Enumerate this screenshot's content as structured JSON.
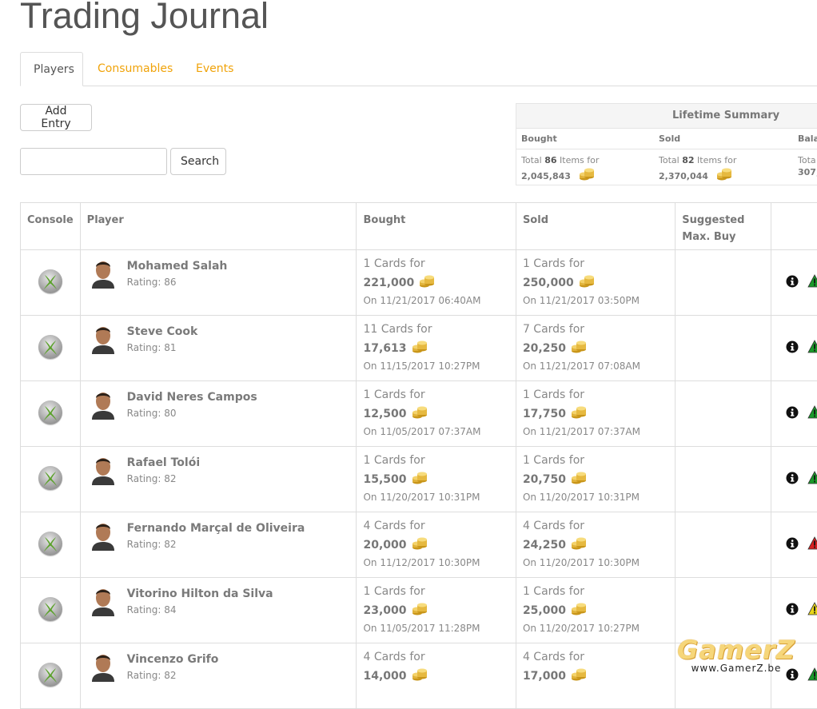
{
  "page": {
    "title": "Trading Journal"
  },
  "tabs": [
    {
      "label": "Players",
      "active": true
    },
    {
      "label": "Consumables",
      "active": false
    },
    {
      "label": "Events",
      "active": false
    }
  ],
  "toolbar": {
    "add_entry_label": "Add Entry",
    "search_label": "Search",
    "search_value": ""
  },
  "summary": {
    "title": "Lifetime Summary",
    "bought": {
      "label": "Bought",
      "prefix": "Total",
      "count": "86",
      "suffix": "Items for",
      "amount": "2,045,843"
    },
    "sold": {
      "label": "Sold",
      "prefix": "Total",
      "count": "82",
      "suffix": "Items for",
      "amount": "2,370,044"
    },
    "balance": {
      "label": "Bala",
      "prefix": "Tota",
      "amount": "307,"
    }
  },
  "table": {
    "headers": {
      "console": "Console",
      "player": "Player",
      "bought": "Bought",
      "sold": "Sold",
      "suggested": "Suggested Max. Buy"
    },
    "rows": [
      {
        "name": "Mohamed Salah",
        "rating": "Rating: 86",
        "bought_cards": "1 Cards for",
        "bought_price": "221,000",
        "bought_date": "On 11/21/2017 06:40AM",
        "sold_cards": "1 Cards for",
        "sold_price": "250,000",
        "sold_date": "On 11/21/2017 03:50PM",
        "warn": "#1a9a2a"
      },
      {
        "name": "Steve Cook",
        "rating": "Rating: 81",
        "bought_cards": "11 Cards for",
        "bought_price": "17,613",
        "bought_date": "On 11/15/2017 10:27PM",
        "sold_cards": "7 Cards for",
        "sold_price": "20,250",
        "sold_date": "On 11/21/2017 07:08AM",
        "warn": "#1a9a2a"
      },
      {
        "name": "David Neres Campos",
        "rating": "Rating: 80",
        "bought_cards": "1 Cards for",
        "bought_price": "12,500",
        "bought_date": "On 11/05/2017 07:37AM",
        "sold_cards": "1 Cards for",
        "sold_price": "17,750",
        "sold_date": "On 11/21/2017 07:37AM",
        "warn": "#1a9a2a"
      },
      {
        "name": "Rafael Tolói",
        "rating": "Rating: 82",
        "bought_cards": "1 Cards for",
        "bought_price": "15,500",
        "bought_date": "On 11/20/2017 10:31PM",
        "sold_cards": "1 Cards for",
        "sold_price": "20,750",
        "sold_date": "On 11/20/2017 10:31PM",
        "warn": "#1a9a2a"
      },
      {
        "name": "Fernando Marçal de Oliveira",
        "rating": "Rating: 82",
        "bought_cards": "4 Cards for",
        "bought_price": "20,000",
        "bought_date": "On 11/12/2017 10:30PM",
        "sold_cards": "4 Cards for",
        "sold_price": "24,250",
        "sold_date": "On 11/20/2017 10:30PM",
        "warn": "#d62020"
      },
      {
        "name": "Vitorino Hilton da Silva",
        "rating": "Rating: 84",
        "bought_cards": "1 Cards for",
        "bought_price": "23,000",
        "bought_date": "On 11/05/2017 11:28PM",
        "sold_cards": "1 Cards for",
        "sold_price": "25,000",
        "sold_date": "On 11/20/2017 10:27PM",
        "warn": "#e8d51a"
      },
      {
        "name": "Vincenzo Grifo",
        "rating": "Rating: 82",
        "bought_cards": "4 Cards for",
        "bought_price": "14,000",
        "bought_date": "",
        "sold_cards": "4 Cards for",
        "sold_price": "17,000",
        "sold_date": "",
        "warn": "#1a9a2a"
      }
    ]
  },
  "watermark": {
    "logo": "GamerZ",
    "url": "www.GamerZ.be"
  }
}
